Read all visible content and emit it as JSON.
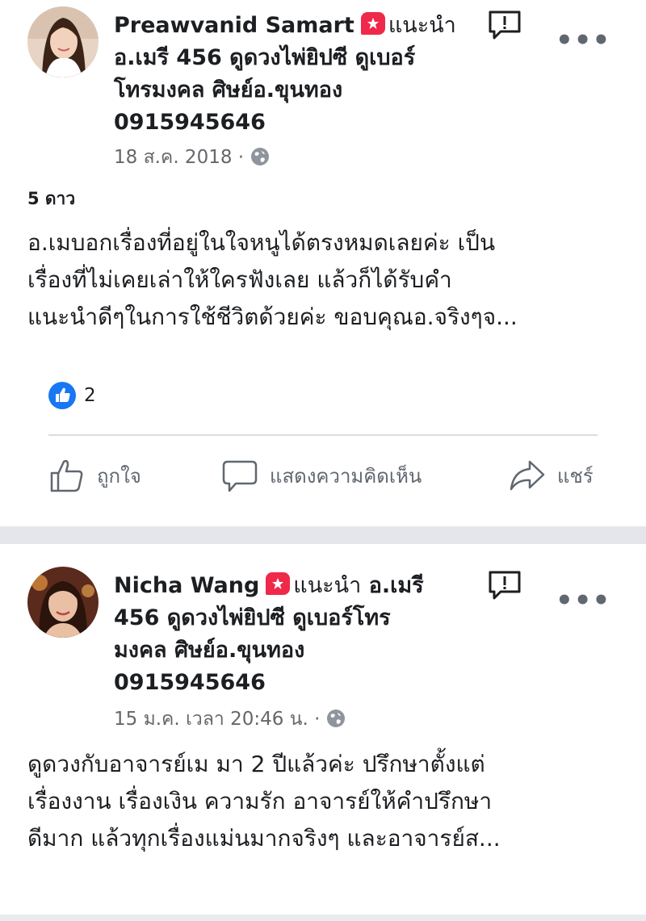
{
  "posts": [
    {
      "author": "Preawvanid Samart",
      "recommend": "แนะนำ",
      "page_name_line1": "อ.เมรี 456 ดูดวงไพ่ยิปซี ดูเบอร์",
      "page_name_line2": "โทรมงคล ศิษย์อ.ขุนทอง",
      "page_name_line3": "0915945646",
      "date": "18 ส.ค. 2018 ·",
      "rating": "5 ดาว",
      "text_lines": [
        "อ.เมบอกเรื่องที่อยู่ในใจหนูได้ตรงหมดเลยค่ะ เป็น",
        "เรื่องที่ไม่เคยเล่าให้ใครฟังเลย แล้วก็ได้รับคำ",
        "แนะนำดีๆในการใช้ชีวิตด้วยค่ะ ขอบคุณอ.จริงๆจ..."
      ],
      "like_count": "2",
      "actions": {
        "like": "ถูกใจ",
        "comment": "แสดงความคิดเห็น",
        "share": "แชร์"
      }
    },
    {
      "author": "Nicha Wang",
      "recommend": "แนะนำ",
      "page_name_inline": "อ.เมรี",
      "page_name_line2": "456 ดูดวงไพ่ยิปซี ดูเบอร์โทร",
      "page_name_line3": "มงคล ศิษย์อ.ขุนทอง",
      "page_name_line4": "0915945646",
      "date": "15 ม.ค. เวลา 20:46 น. ·",
      "text_lines": [
        "ดูดวงกับอาจารย์เม มา 2 ปีแล้วค่ะ ปรึกษาตั้งแต่",
        "เรื่องงาน เรื่องเงิน ความรัก  อาจารย์ให้คำปรึกษา",
        "ดีมาก แล้วทุกเรื่องแม่นมากจริงๆ และอาจารย์ส..."
      ]
    }
  ],
  "more_label": "•••",
  "colors": {
    "accent": "#1877f2",
    "recommend_badge": "#f02849",
    "meta": "#65676b"
  },
  "icons": [
    "recommend-badge-icon",
    "report-icon",
    "more-icon",
    "globe-icon",
    "like-reaction-icon",
    "thumbs-up-icon",
    "comment-icon",
    "share-icon"
  ]
}
